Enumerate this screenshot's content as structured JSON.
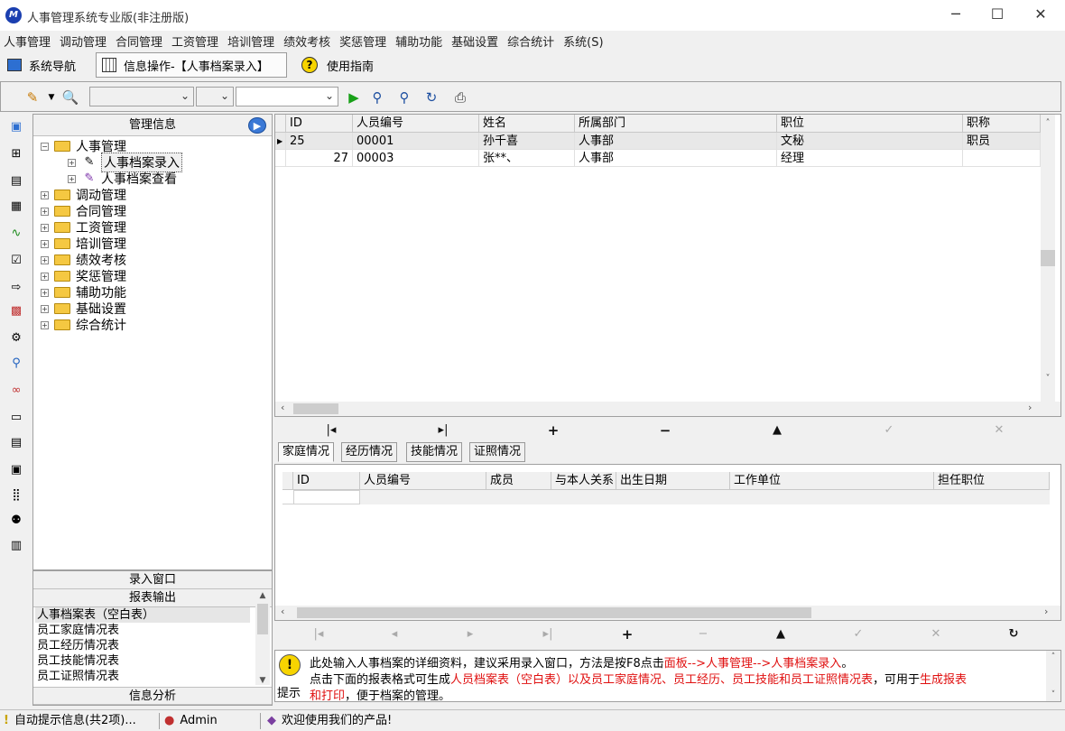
{
  "window": {
    "title": "人事管理系统专业版(非注册版)",
    "app_icon_text": "M"
  },
  "menu": [
    "人事管理",
    "调动管理",
    "合同管理",
    "工资管理",
    "培训管理",
    "绩效考核",
    "奖惩管理",
    "辅助功能",
    "基础设置",
    "综合统计",
    "系统(S)"
  ],
  "navtabs": {
    "nav": "系统导航",
    "info": "信息操作-【人事档案录入】",
    "guide": "使用指南"
  },
  "tree": {
    "header": "管理信息",
    "root": "人事管理",
    "children": [
      "人事档案录入",
      "人事档案查看"
    ],
    "siblings": [
      "调动管理",
      "合同管理",
      "工资管理",
      "培训管理",
      "绩效考核",
      "奖惩管理",
      "辅助功能",
      "基础设置",
      "综合统计"
    ]
  },
  "reports": {
    "header_entry": "录入窗口",
    "header_output": "报表输出",
    "items": [
      "人事档案表（空白表）",
      "员工家庭情况表",
      "员工经历情况表",
      "员工技能情况表",
      "员工证照情况表"
    ],
    "header_analysis": "信息分析"
  },
  "grid1": {
    "columns": [
      "ID",
      "人员编号",
      "姓名",
      "所属部门",
      "职位",
      "职称"
    ],
    "rows": [
      [
        "25",
        "00001",
        "孙千喜",
        "人事部",
        "文秘",
        "职员"
      ],
      [
        "27",
        "00003",
        "张**、",
        "人事部",
        "经理",
        ""
      ]
    ]
  },
  "subtabs": [
    "家庭情况",
    "经历情况",
    "技能情况",
    "证照情况"
  ],
  "grid2": {
    "columns": [
      "ID",
      "人员编号",
      "成员",
      "与本人关系",
      "出生日期",
      "工作单位",
      "担任职位"
    ]
  },
  "hint": {
    "label": "提示",
    "line1_a": "此处输入人事档案的详细资料，建议采用录入窗口，方法是按F8点击",
    "line1_b": "面板-->人事管理-->人事档案录入",
    "line1_c": "。",
    "line2_a": "点击下面的报表格式可生成",
    "line2_b": "人员档案表（空白表）以及员工家庭情况、员工经历、员工技能和员工证照情况表",
    "line2_c": "，可用于",
    "line2_d": "生成报表",
    "line3_a": "和打印",
    "line3_b": "，便于档案的管理。"
  },
  "status": {
    "tips": "自动提示信息(共2项)...",
    "user": "Admin",
    "welcome": "欢迎使用我们的产品!"
  }
}
